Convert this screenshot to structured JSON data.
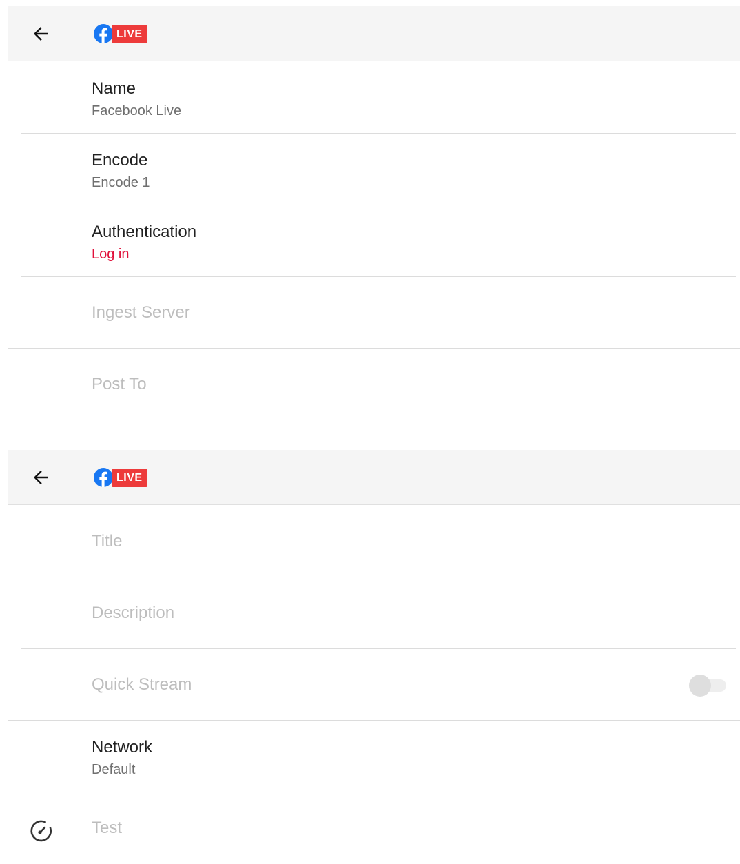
{
  "screen1": {
    "header": {
      "back_icon": "arrow-left-icon",
      "logo_icon": "facebook-icon",
      "badge": "LIVE"
    },
    "rows": {
      "name": {
        "title": "Name",
        "subtitle": "Facebook Live"
      },
      "encode": {
        "title": "Encode",
        "subtitle": "Encode 1"
      },
      "authentication": {
        "title": "Authentication",
        "subtitle": "Log in"
      },
      "ingest_server": {
        "title": "Ingest Server"
      },
      "post_to": {
        "title": "Post To"
      }
    }
  },
  "screen2": {
    "header": {
      "back_icon": "arrow-left-icon",
      "logo_icon": "facebook-icon",
      "badge": "LIVE"
    },
    "rows": {
      "title": {
        "title": "Title"
      },
      "description": {
        "title": "Description"
      },
      "quick_stream": {
        "title": "Quick Stream",
        "toggle_on": false
      },
      "network": {
        "title": "Network",
        "subtitle": "Default"
      },
      "test": {
        "title": "Test",
        "icon": "speedometer-icon"
      }
    }
  },
  "colors": {
    "accent": "#e0103a",
    "live_badge": "#ed3b3b",
    "facebook_blue": "#1877f2",
    "header_bg": "#f5f5f5"
  }
}
